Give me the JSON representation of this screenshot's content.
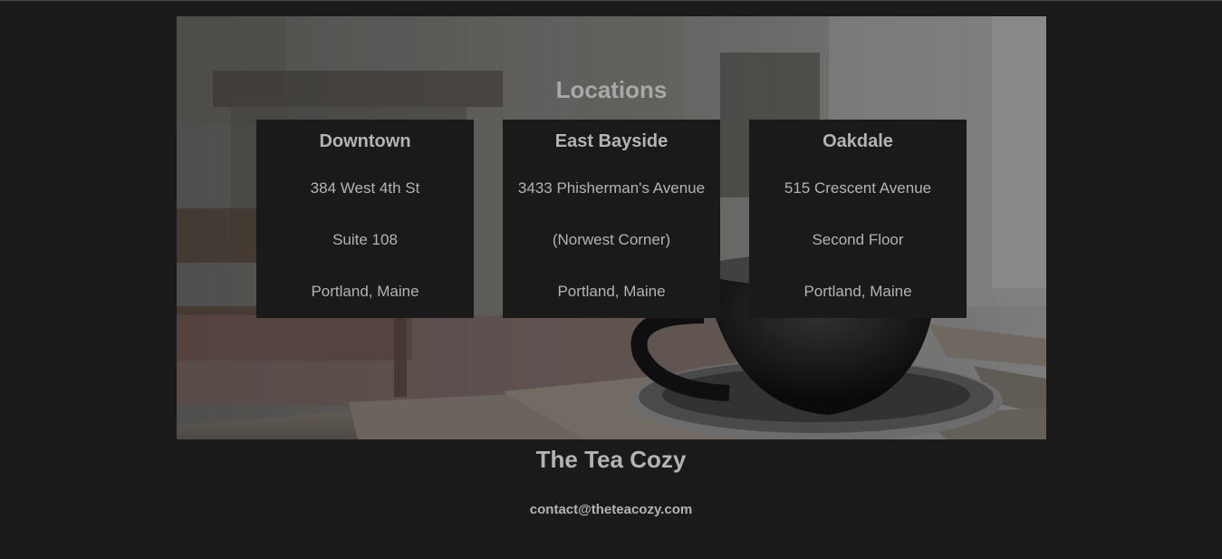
{
  "hero": {
    "image": "coffee-cup-on-wooden-table-photo",
    "heading": "Locations"
  },
  "locations": [
    {
      "name": "Downtown",
      "line1": "384 West 4th St",
      "line2": "Suite 108",
      "line3": "Portland, Maine"
    },
    {
      "name": "East Bayside",
      "line1": "3433 Phisherman's Avenue",
      "line2": "(Norwest Corner)",
      "line3": "Portland, Maine"
    },
    {
      "name": "Oakdale",
      "line1": "515 Crescent Avenue",
      "line2": "Second Floor",
      "line3": "Portland, Maine"
    }
  ],
  "footer": {
    "title": "The Tea Cozy",
    "email": "contact@theteacozy.com"
  },
  "colors": {
    "page_background": "#1a1a1a",
    "card_background": "#1a1a1a",
    "text": "#b3b3b3"
  }
}
